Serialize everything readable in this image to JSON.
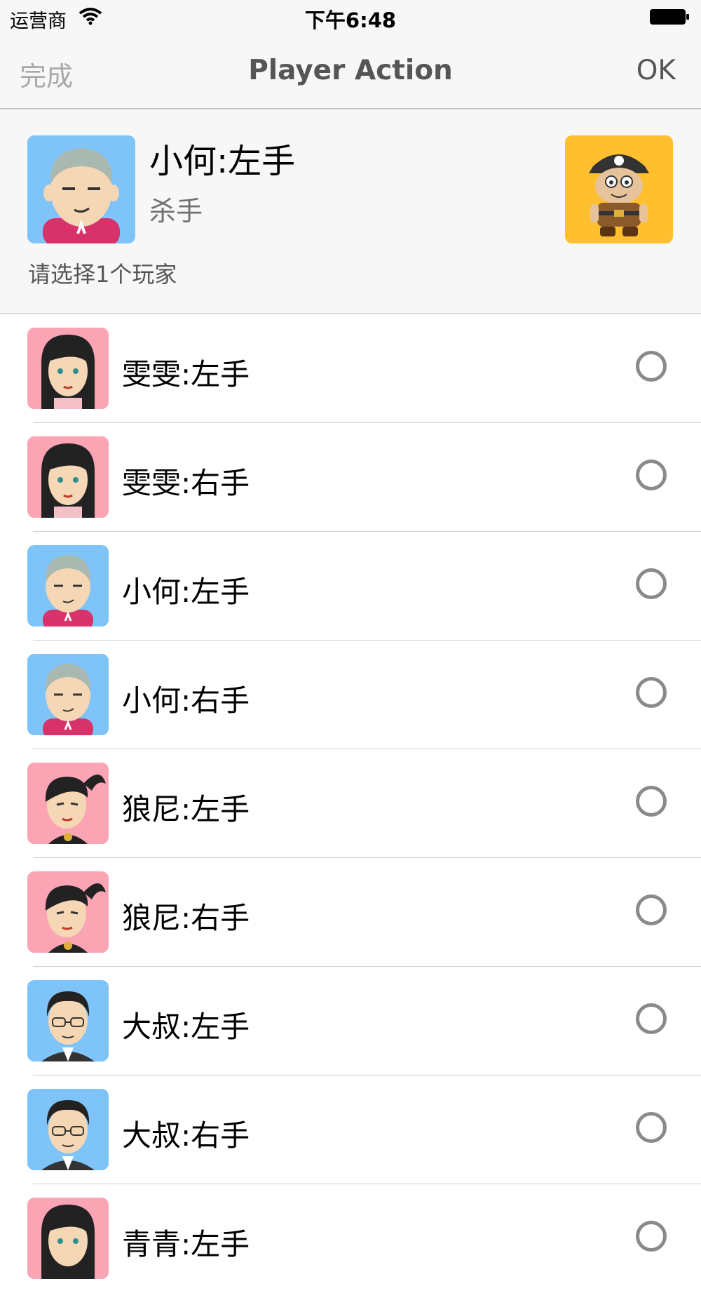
{
  "status_bar": {
    "carrier": "运营商",
    "time": "下午6:48"
  },
  "nav_bar": {
    "left_label": "完成",
    "title": "Player Action",
    "right_label": "OK"
  },
  "header": {
    "player_name": "小何:左手",
    "role": "杀手",
    "hint": "请选择1个玩家",
    "role_icon": "pirate-character-icon"
  },
  "players": [
    {
      "name": "雯雯:左手",
      "avatar": "female-long-hair-avatar",
      "selected": false
    },
    {
      "name": "雯雯:右手",
      "avatar": "female-long-hair-avatar",
      "selected": false
    },
    {
      "name": "小何:左手",
      "avatar": "gray-hair-boy-avatar",
      "selected": false
    },
    {
      "name": "小何:右手",
      "avatar": "gray-hair-boy-avatar",
      "selected": false
    },
    {
      "name": "狼尼:左手",
      "avatar": "ponytail-girl-avatar",
      "selected": false
    },
    {
      "name": "狼尼:右手",
      "avatar": "ponytail-girl-avatar",
      "selected": false
    },
    {
      "name": "大叔:左手",
      "avatar": "glasses-man-avatar",
      "selected": false
    },
    {
      "name": "大叔:右手",
      "avatar": "glasses-man-avatar",
      "selected": false
    },
    {
      "name": "青青:左手",
      "avatar": "female-long-hair-avatar",
      "selected": false
    }
  ],
  "colors": {
    "nav_background": "#f7f7f7",
    "avatar_pink": "#fba5b4",
    "avatar_blue": "#7ec4f8",
    "role_card": "#ffbf2f",
    "radio_border": "#8a8a8a"
  }
}
